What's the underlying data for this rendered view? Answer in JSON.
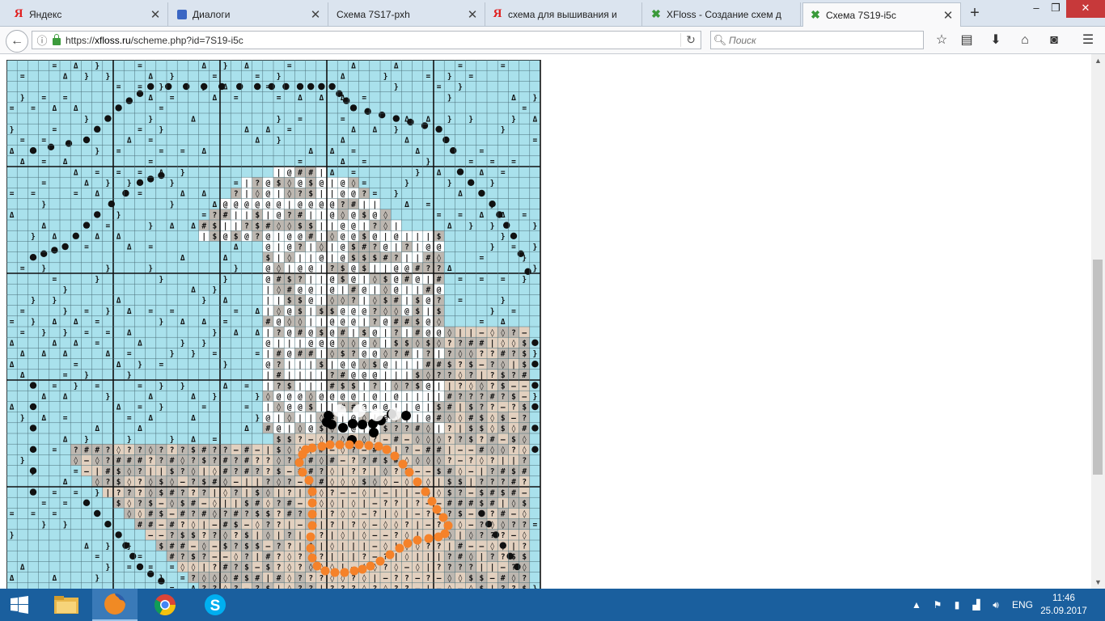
{
  "browser": {
    "tabs": [
      {
        "title": "Яндекс",
        "icon": "yandex-icon",
        "active": false
      },
      {
        "title": "Диалоги",
        "icon": "dialogs-icon",
        "active": false
      },
      {
        "title": "Схема 7S17-pxh",
        "icon": "",
        "active": false
      },
      {
        "title": "схема для вышивания и",
        "icon": "yandex-icon",
        "active": false
      },
      {
        "title": "XFloss - Создание схем д",
        "icon": "xfloss-icon",
        "active": false
      },
      {
        "title": "Схема 7S19-i5c",
        "icon": "xfloss-icon",
        "active": true
      }
    ],
    "new_tab_label": "+",
    "window_controls": {
      "minimize": "–",
      "maximize": "❐",
      "close": "✕"
    }
  },
  "navbar": {
    "url_prefix": "https://",
    "url_host": "xfloss.ru",
    "url_path": "/scheme.php?id=7S19-i5c",
    "search_placeholder": "Поиск",
    "toolbar_icons": [
      "bookmark-star-icon",
      "reading-list-icon",
      "download-icon",
      "home-icon",
      "pocket-icon",
      "menu-icon"
    ]
  },
  "scheme": {
    "id": "7S19-i5c",
    "columns": 50,
    "rows": 50,
    "colors": {
      "sky": "#a9e1ec",
      "light": "#ffffff",
      "grey": "#bdb7b0",
      "beige": "#e2d0bf",
      "dark_grey": "#a8a39c",
      "grid": "#4a6e78",
      "major_grid": "#111111",
      "paint_orange": "#f5822a",
      "paint_black": "#000000"
    },
    "symbol_key": {
      "sky": [
        "=",
        "Δ",
        "}"
      ],
      "grey": [
        "$",
        "#",
        "◊",
        "?"
      ],
      "light": [
        "@",
        "|"
      ],
      "beige": [
        "?",
        "|",
        "—",
        "◊"
      ],
      "dark": [
        "●"
      ]
    }
  },
  "taskbar": {
    "apps": [
      {
        "name": "file-explorer-icon",
        "active": false
      },
      {
        "name": "firefox-icon",
        "active": true
      },
      {
        "name": "chrome-icon",
        "active": false
      },
      {
        "name": "skype-icon",
        "active": false
      }
    ],
    "language": "ENG",
    "time": "11:46",
    "date": "25.09.2017"
  }
}
